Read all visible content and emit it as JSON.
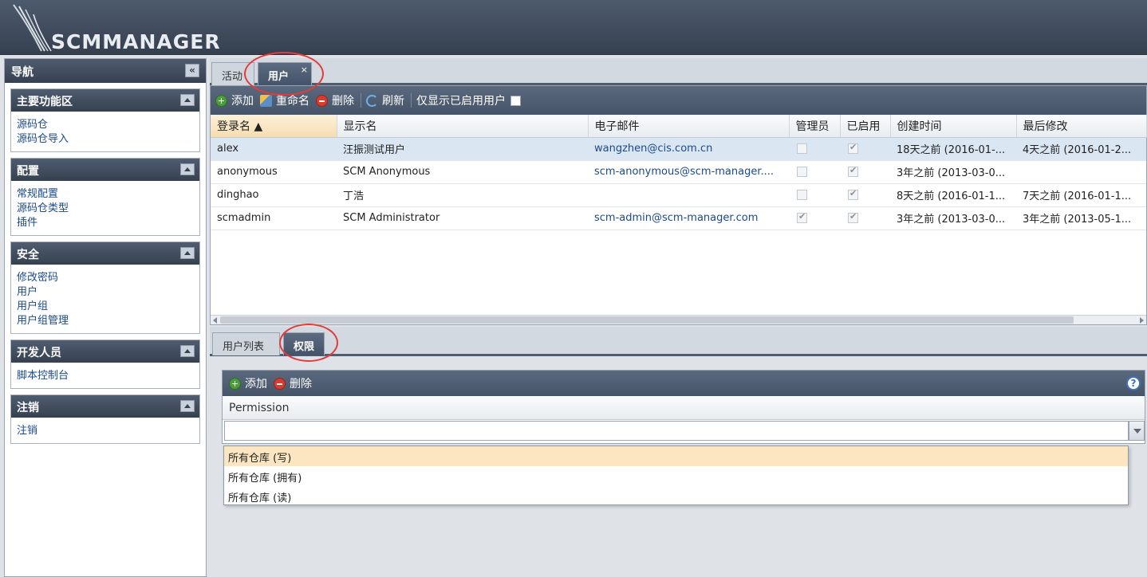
{
  "app": {
    "logo_text": "SCMMANAGER"
  },
  "sidebar": {
    "title": "导航",
    "panels": [
      {
        "title": "主要功能区",
        "items": [
          "源码仓",
          "源码仓导入"
        ]
      },
      {
        "title": "配置",
        "items": [
          "常规配置",
          "源码仓类型",
          "插件"
        ]
      },
      {
        "title": "安全",
        "items": [
          "修改密码",
          "用户",
          "用户组",
          "用户组管理"
        ]
      },
      {
        "title": "开发人员",
        "items": [
          "脚本控制台"
        ]
      },
      {
        "title": "注销",
        "items": [
          "注销"
        ]
      }
    ]
  },
  "tabs": [
    {
      "label": "活动",
      "active": false
    },
    {
      "label": "用户",
      "active": true,
      "close": "×"
    }
  ],
  "toolbar": {
    "add": "添加",
    "rename": "重命名",
    "delete": "删除",
    "refresh": "刷新",
    "only_enabled": "仅显示已启用用户"
  },
  "grid": {
    "columns": [
      "登录名 ▲",
      "显示名",
      "电子邮件",
      "管理员",
      "已启用",
      "创建时间",
      "最后修改"
    ],
    "rows": [
      {
        "login": "alex",
        "display": "汪振测试用户",
        "email": "wangzhen@cis.com.cn",
        "admin": false,
        "enabled": true,
        "created": "18天之前 (2016-01-...",
        "modified": "4天之前 (2016-01-2..."
      },
      {
        "login": "anonymous",
        "display": "SCM Anonymous",
        "email": "scm-anonymous@scm-manager....",
        "admin": false,
        "enabled": true,
        "created": "3年之前 (2013-03-0...",
        "modified": ""
      },
      {
        "login": "dinghao",
        "display": "丁浩",
        "email": "",
        "admin": false,
        "enabled": true,
        "created": "8天之前 (2016-01-1...",
        "modified": "7天之前 (2016-01-1..."
      },
      {
        "login": "scmadmin",
        "display": "SCM Administrator",
        "email": "scm-admin@scm-manager.com",
        "admin": true,
        "enabled": true,
        "created": "3年之前 (2013-03-0...",
        "modified": "3年之前 (2013-05-1..."
      }
    ]
  },
  "detail_tabs": [
    {
      "label": "用户列表",
      "active": false
    },
    {
      "label": "权限",
      "active": true
    }
  ],
  "permissions": {
    "add": "添加",
    "delete": "删除",
    "help": "?",
    "column": "Permission",
    "input_value": "",
    "options": [
      "所有仓库 (写)",
      "所有仓库 (拥有)",
      "所有仓库 (读)"
    ],
    "highlighted_option": 0
  },
  "colors": {
    "accent_ring": "#e43a3a",
    "header_bg": "#4e5b6e",
    "link": "#1a4a8a"
  }
}
